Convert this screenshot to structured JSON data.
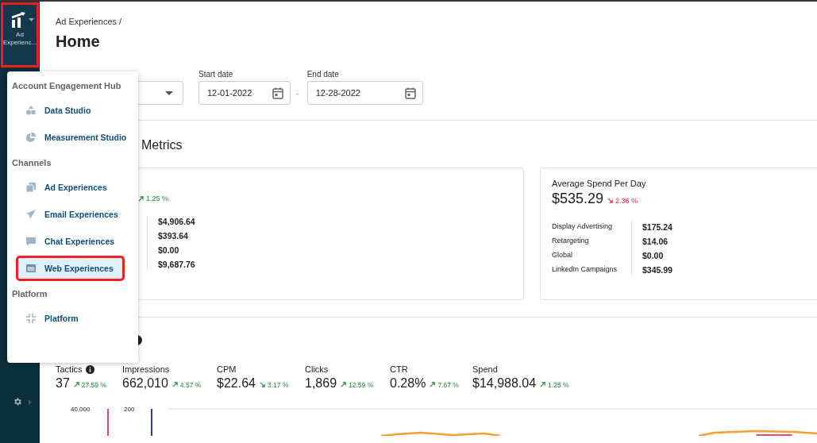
{
  "sidebar": {
    "app": {
      "label": "Ad Experienc...",
      "highlighted": true
    }
  },
  "menu": {
    "groups": [
      {
        "title": "Account Engagement Hub",
        "items": [
          {
            "label": "Data Studio",
            "selected": false,
            "highlighted": false
          },
          {
            "label": "Measurement Studio",
            "selected": false,
            "highlighted": false
          }
        ]
      },
      {
        "title": "Channels",
        "items": [
          {
            "label": "Ad Experiences",
            "selected": false,
            "highlighted": false
          },
          {
            "label": "Email Experiences",
            "selected": false,
            "highlighted": false
          },
          {
            "label": "Chat Experiences",
            "selected": false,
            "highlighted": false
          },
          {
            "label": "Web Experiences",
            "selected": true,
            "highlighted": true
          }
        ]
      },
      {
        "title": "Platform",
        "items": [
          {
            "label": "Platform",
            "selected": false,
            "highlighted": false
          }
        ]
      }
    ]
  },
  "breadcrumb": "Ad Experiences /",
  "title": "Home",
  "filters": {
    "start_date": {
      "label": "Start date",
      "value": "12-01-2022"
    },
    "separator": "-",
    "end_date": {
      "label": "End date",
      "value": "12-28-2022"
    }
  },
  "metrics": {
    "heading": "Metrics",
    "cards": [
      {
        "change": "1.25 %",
        "rising": true,
        "positive": true,
        "rows": [
          {
            "value": "$4,906.64"
          },
          {
            "value": "$393.64"
          },
          {
            "value": "$0.00"
          },
          {
            "value": "$9,687.76"
          }
        ]
      },
      {
        "title": "Average Spend Per Day",
        "value": "$535.29",
        "change": "2.36 %",
        "rising": false,
        "positive": false,
        "rows": [
          {
            "label": "Display Advertising",
            "value": "$175.24"
          },
          {
            "label": "Retargeting",
            "value": "$14.06"
          },
          {
            "label": "Global",
            "value": "$0.00"
          },
          {
            "label": "LinkedIn Campaigns",
            "value": "$345.99"
          }
        ]
      }
    ]
  },
  "kpis": [
    {
      "label": "Tactics",
      "info": true,
      "value": "37",
      "change": "27.59 %",
      "rising": true,
      "positive": true
    },
    {
      "label": "Impressions",
      "info": false,
      "value": "662,010",
      "change": "4.57 %",
      "rising": true,
      "positive": true
    },
    {
      "label": "CPM",
      "info": false,
      "value": "$22.64",
      "change": "3.17 %",
      "rising": false,
      "positive": true
    },
    {
      "label": "Clicks",
      "info": false,
      "value": "1,869",
      "change": "12.59 %",
      "rising": true,
      "positive": true
    },
    {
      "label": "CTR",
      "info": false,
      "value": "0.28%",
      "change": "7.67 %",
      "rising": true,
      "positive": true
    },
    {
      "label": "Spend",
      "info": false,
      "value": "$14,988.04",
      "change": "1.25 %",
      "rising": true,
      "positive": true
    }
  ],
  "chart": {
    "axis_labels": [
      "40,000",
      "200"
    ]
  }
}
